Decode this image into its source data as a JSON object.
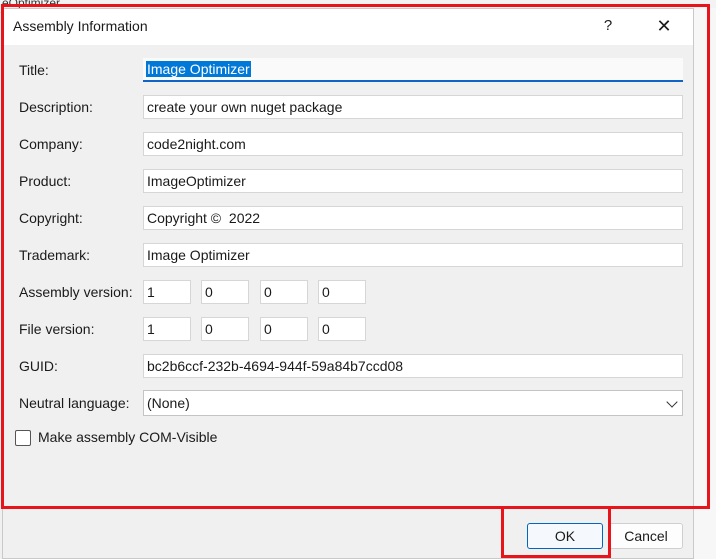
{
  "background": {
    "partial_text": "eOptimizer"
  },
  "dialog": {
    "title": "Assembly Information",
    "help_glyph": "?",
    "close_glyph": "✕"
  },
  "fields": {
    "title": {
      "label": "Title:",
      "value": "Image Optimizer"
    },
    "description": {
      "label": "Description:",
      "value": "create your own nuget package"
    },
    "company": {
      "label": "Company:",
      "value": "code2night.com"
    },
    "product": {
      "label": "Product:",
      "value": "ImageOptimizer"
    },
    "copyright": {
      "label": "Copyright:",
      "value": "Copyright ©  2022"
    },
    "trademark": {
      "label": "Trademark:",
      "value": "Image Optimizer"
    },
    "guid": {
      "label": "GUID:",
      "value": "bc2b6ccf-232b-4694-944f-59a84b7ccd08"
    }
  },
  "assembly_version": {
    "label": "Assembly version:",
    "parts": [
      "1",
      "0",
      "0",
      "0"
    ]
  },
  "file_version": {
    "label": "File version:",
    "parts": [
      "1",
      "0",
      "0",
      "0"
    ]
  },
  "neutral_language": {
    "label": "Neutral language:",
    "selected": "(None)"
  },
  "com_visible": {
    "label": "Make assembly COM-Visible",
    "checked": false
  },
  "buttons": {
    "ok": "OK",
    "cancel": "Cancel"
  },
  "colors": {
    "annotation": "#e8141b",
    "selection": "#0078d7",
    "focus_underline": "#0f64c8",
    "default_button_border": "#0067c0"
  }
}
